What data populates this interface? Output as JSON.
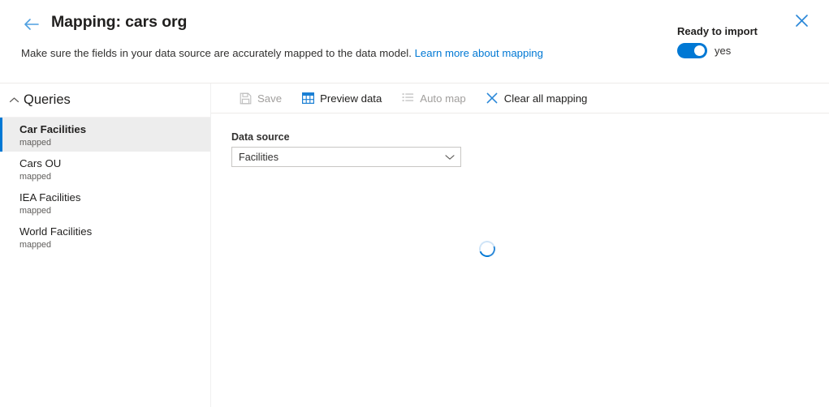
{
  "header": {
    "back_icon": "arrow-left-icon",
    "title": "Mapping: cars org",
    "subtitle_text": "Make sure the fields in your data source are accurately mapped to the data model.",
    "subtitle_link": "Learn more about mapping",
    "ready_label": "Ready to import",
    "toggle_value": "yes",
    "toggle_on": true,
    "close_icon": "close-icon",
    "accent_color": "#0078d4"
  },
  "sidebar": {
    "section_title": "Queries",
    "chevron_icon": "chevron-up-icon",
    "items": [
      {
        "label": "Car Facilities",
        "status": "mapped",
        "selected": true
      },
      {
        "label": "Cars OU",
        "status": "mapped",
        "selected": false
      },
      {
        "label": "IEA Facilities",
        "status": "mapped",
        "selected": false
      },
      {
        "label": "World Facilities",
        "status": "mapped",
        "selected": false
      }
    ]
  },
  "toolbar": {
    "buttons": [
      {
        "label": "Save",
        "icon": "save-icon",
        "enabled": false
      },
      {
        "label": "Preview data",
        "icon": "table-icon",
        "enabled": true
      },
      {
        "label": "Auto map",
        "icon": "list-icon",
        "enabled": false
      },
      {
        "label": "Clear all mapping",
        "icon": "close-x-icon",
        "enabled": true
      }
    ]
  },
  "main": {
    "data_source_label": "Data source",
    "data_source_value": "Facilities",
    "dropdown_chevron": "chevron-down-icon",
    "loading": true,
    "spinner_icon": "loading-spinner-icon"
  }
}
